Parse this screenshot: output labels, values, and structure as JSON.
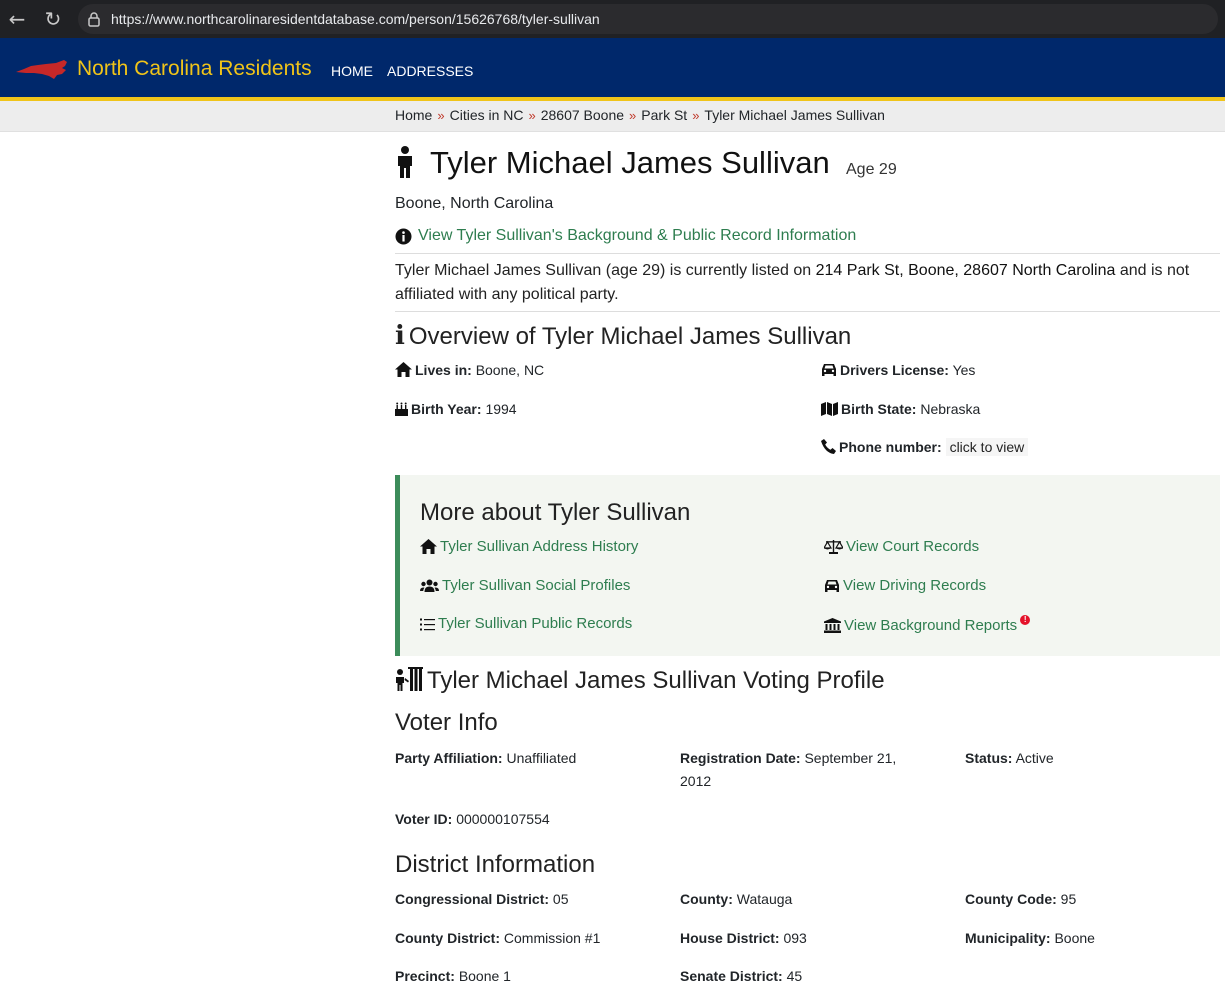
{
  "browser": {
    "url": "https://www.northcarolinaresidentdatabase.com/person/15626768/tyler-sullivan"
  },
  "header": {
    "brand": "North Carolina Residents",
    "nav": [
      "HOME",
      "ADDRESSES"
    ],
    "colors": {
      "bar": "#00286b",
      "brand": "#f0c419",
      "map": "#c62828"
    }
  },
  "breadcrumb": [
    "Home",
    "Cities in NC",
    "28607 Boone",
    "Park St",
    "Tyler Michael James Sullivan"
  ],
  "breadcrumb_sep": "»",
  "person": {
    "name": "Tyler Michael James Sullivan",
    "age": "Age 29",
    "location": "Boone,  North Carolina",
    "background_link": "View Tyler Sullivan's Background & Public Record Information"
  },
  "summary": {
    "prefix": "Tyler Michael James Sullivan (age 29) is currently listed on ",
    "address": "214 Park St, Boone, 28607 North Carolina",
    "suffix": " and is not affiliated with any political party."
  },
  "overview": {
    "title": "Overview of Tyler Michael James Sullivan",
    "lives_in": {
      "label": "Lives in:",
      "value": "Boone, NC"
    },
    "drivers_license": {
      "label": "Drivers License:",
      "value": "Yes"
    },
    "birth_year": {
      "label": "Birth Year:",
      "value": "1994"
    },
    "birth_state": {
      "label": "Birth State:",
      "value": "Nebraska"
    },
    "phone": {
      "label": "Phone number:",
      "value": "click to view"
    }
  },
  "more": {
    "title": "More about Tyler Sullivan",
    "links": [
      "Tyler Sullivan Address History",
      "View Court Records",
      "Tyler Sullivan Social Profiles",
      "View Driving Records",
      "Tyler Sullivan Public Records",
      "View Background Reports"
    ],
    "badge": "!"
  },
  "voting": {
    "title": "Tyler Michael James Sullivan Voting Profile",
    "voter_info_title": "Voter Info",
    "party": {
      "label": "Party Affiliation:",
      "value": "Unaffiliated"
    },
    "registration": {
      "label": "Registration Date:",
      "value": "September 21, 2012"
    },
    "status": {
      "label": "Status:",
      "value": "Active"
    },
    "voter_id": {
      "label": "Voter ID:",
      "value": "000000107554"
    },
    "district_title": "District Information",
    "congressional": {
      "label": "Congressional District:",
      "value": "05"
    },
    "county": {
      "label": "County:",
      "value": "Watauga"
    },
    "county_code": {
      "label": "County Code:",
      "value": "95"
    },
    "county_district": {
      "label": "County District:",
      "value": "Commission #1"
    },
    "house_district": {
      "label": "House District:",
      "value": "093"
    },
    "municipality": {
      "label": "Municipality:",
      "value": "Boone"
    },
    "precinct": {
      "label": "Precinct:",
      "value": "Boone 1"
    },
    "senate_district": {
      "label": "Senate District:",
      "value": "45"
    }
  }
}
